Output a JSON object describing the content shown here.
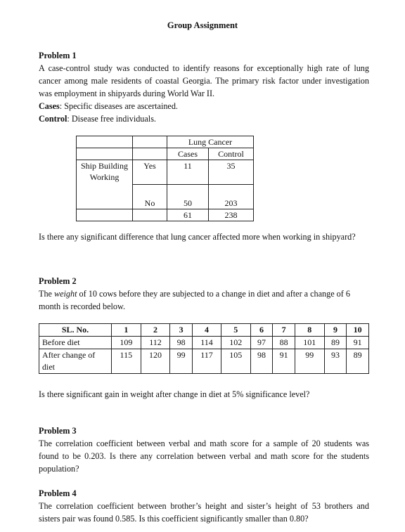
{
  "title": "Group Assignment",
  "problems": [
    {
      "heading": "Problem 1",
      "text": "A case-control study was conducted to identify reasons for exceptionally high rate of lung cancer among male residents of coastal Georgia. The primary risk factor under investigation was employment in shipyards during World War II.",
      "cases_label": "Cases",
      "cases_text": ": Specific diseases are ascertained.",
      "control_label": "Control",
      "control_text": ": Disease free individuals.",
      "table": {
        "group_header": "Lung Cancer",
        "col_headers": [
          "Cases",
          "Control"
        ],
        "row_label": "Ship Building Working",
        "rows": [
          {
            "label": "Yes",
            "cases": "11",
            "control": "35"
          },
          {
            "label": "No",
            "cases": "50",
            "control": "203"
          }
        ],
        "totals": {
          "cases": "61",
          "control": "238"
        }
      },
      "question": "Is there any significant difference that lung cancer affected more when working in shipyard?"
    },
    {
      "heading": "Problem 2",
      "text_pre": "The ",
      "text_em": "weight",
      "text_post": " of 10 cows before they are subjected to a change in diet and after a change of 6 month is recorded below.",
      "table": {
        "header_label": "SL. No.",
        "numbers": [
          "1",
          "2",
          "3",
          "4",
          "5",
          "6",
          "7",
          "8",
          "9",
          "10"
        ],
        "before_label": "Before diet",
        "before": [
          "109",
          "112",
          "98",
          "114",
          "102",
          "97",
          "88",
          "101",
          "89",
          "91"
        ],
        "after_label": "After change of diet",
        "after": [
          "115",
          "120",
          "99",
          "117",
          "105",
          "98",
          "91",
          "99",
          "93",
          "89"
        ]
      },
      "question": "Is there significant gain in weight after change in diet at 5% significance level?"
    },
    {
      "heading": "Problem 3",
      "text": "The correlation coefficient between verbal and math score for a sample of 20 students was found to be 0.203. Is there any correlation between verbal and math score for the students population?"
    },
    {
      "heading": "Problem 4",
      "text": "The correlation coefficient between brother’s height and sister’s height of 53 brothers and sisters pair was found 0.585.  Is this coefficient significantly smaller than 0.80?"
    }
  ]
}
